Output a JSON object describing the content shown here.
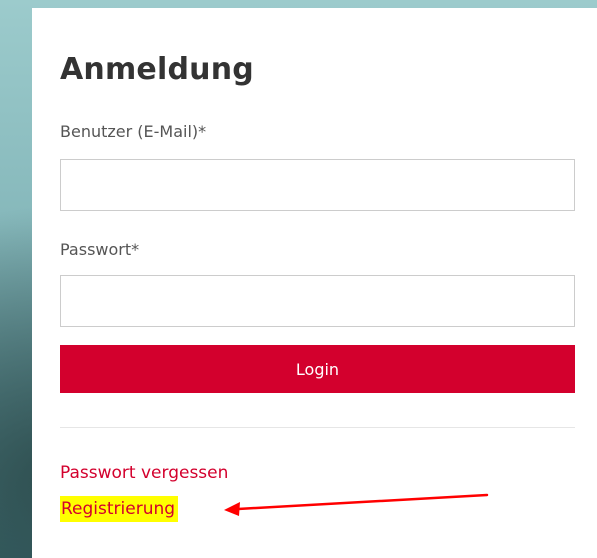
{
  "login_form": {
    "title": "Anmeldung",
    "user_label": "Benutzer (E-Mail)*",
    "user_value": "",
    "password_label": "Passwort*",
    "password_value": "",
    "login_button_label": "Login",
    "forgot_password_link": "Passwort vergessen",
    "register_link": "Registrierung"
  },
  "annotation": {
    "highlight_color": "#ffff00",
    "arrow_color": "#ff0000",
    "arrow_target": "register-link"
  },
  "colors": {
    "accent": "#d3002d",
    "title_text": "#333333",
    "label_text": "#555555"
  }
}
